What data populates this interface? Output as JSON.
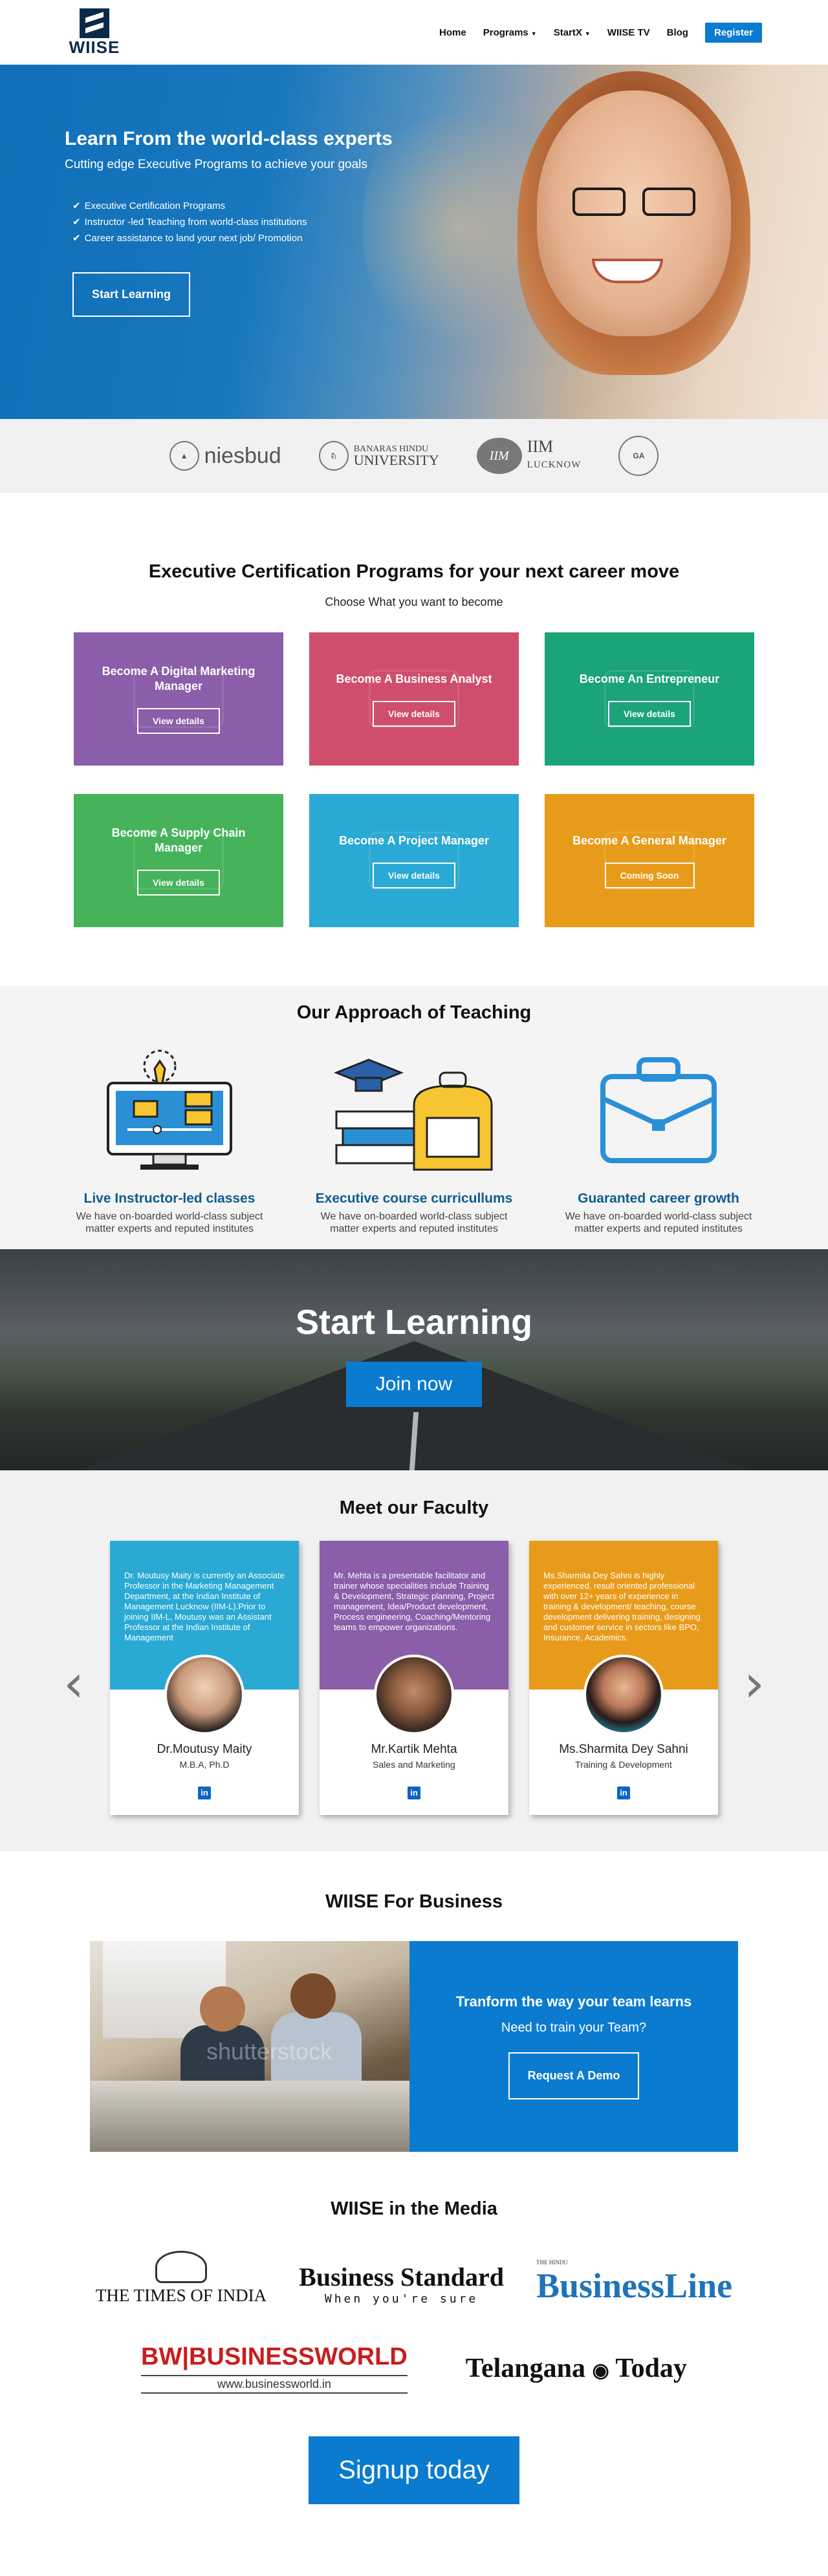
{
  "nav": {
    "logo_text": "WIISE",
    "items": [
      {
        "label": "Home"
      },
      {
        "label": "Programs"
      },
      {
        "label": "StartX"
      },
      {
        "label": "WIISE TV"
      },
      {
        "label": "Blog"
      }
    ],
    "register": "Register"
  },
  "hero": {
    "title": "Learn From the world-class experts",
    "subtitle": "Cutting edge Executive Programs to achieve your goals",
    "bullets": [
      "Executive Certification Programs",
      "Instructor -led Teaching from world-class institutions",
      "Career assistance to land your next job/ Promotion"
    ],
    "cta": "Start Learning"
  },
  "partners": {
    "niesbud": "niesbud",
    "bhu_line1": "BANARAS HINDU",
    "bhu_line2": "UNIVERSITY",
    "iim_badge": "IIM",
    "iim_line1": "IIM",
    "iim_line2": "LUCKNOW",
    "ga_badge": "GA"
  },
  "programs": {
    "title": "Executive Certification Programs for your next career move",
    "subtitle": "Choose What you want to become",
    "cards": [
      {
        "title": "Become A Digital Marketing Manager",
        "button": "View details",
        "color": "#8a5ea8"
      },
      {
        "title": "Become A Business Analyst",
        "button": "View details",
        "color": "#cf4e6c"
      },
      {
        "title": "Become An Entrepreneur",
        "button": "View details",
        "color": "#1ba37a"
      },
      {
        "title": "Become A Supply Chain Manager",
        "button": "View details",
        "color": "#46b35a"
      },
      {
        "title": "Become A Project Manager",
        "button": "View details",
        "color": "#2aa9d4"
      },
      {
        "title": "Become A General Manager",
        "button": "Coming Soon",
        "color": "#e89b1a"
      }
    ]
  },
  "approach": {
    "title": "Our Approach of Teaching",
    "items": [
      {
        "title": "Live Instructor-led classes",
        "text": "We have on-boarded world-class subject matter experts and reputed institutes"
      },
      {
        "title": "Executive course curricullums",
        "text": "We have on-boarded world-class subject matter experts and reputed institutes"
      },
      {
        "title": "Guaranted career growth",
        "text": "We have on-boarded world-class subject matter experts and reputed institutes"
      }
    ]
  },
  "start": {
    "title": "Start Learning",
    "button": "Join now"
  },
  "faculty": {
    "title": "Meet our Faculty",
    "members": [
      {
        "bio": "Dr. Moutusy Maity is currently an Associate Professor in the Marketing Management Department, at the Indian Institute of Management Lucknow (IIM-L).Prior to joining IIM-L, Moutusy was an Assistant Professor at the Indian Institute of Management",
        "name": "Dr.Moutusy Maity",
        "role": "M.B.A, Ph.D",
        "color": "#2aa9d4"
      },
      {
        "bio": "Mr. Mehta is a presentable facilitator and trainer whose specialities include Training & Development, Strategic planning, Project management, Idea/Product development, Process engineering, Coaching/Mentoring teams to empower organizations.",
        "name": "Mr.Kartik Mehta",
        "role": "Sales and Marketing",
        "color": "#8a5ea8"
      },
      {
        "bio": "Ms.Sharmita Dey Sahni is highly experienced, result oriented professional with over 12+ years of experience in training & development/ teaching, course development delivering training, designing and customer service in sectors like BPO, Insurance, Academics.",
        "name": "Ms.Sharmita Dey Sahni",
        "role": "Training & Development",
        "color": "#e89b1a"
      }
    ],
    "linkedin": "in"
  },
  "business": {
    "title": "WIISE For Business",
    "heading": "Tranform the way your team learns",
    "question": "Need to train your Team?",
    "button": "Request A Demo",
    "watermark": "shutterstock"
  },
  "media": {
    "title": "WIISE in the Media",
    "toi": "THE TIMES OF INDIA",
    "bs_title": "Business Standard",
    "bs_tagline": "When you're sure",
    "bl_small": "THE HINDU",
    "bl_title": "BusinessLine",
    "bw_title": "BW|BUSINESSWORLD",
    "bw_url": "www.businessworld.in",
    "tt_left": "Telangana",
    "tt_right": "Today"
  },
  "signup": "Signup today"
}
